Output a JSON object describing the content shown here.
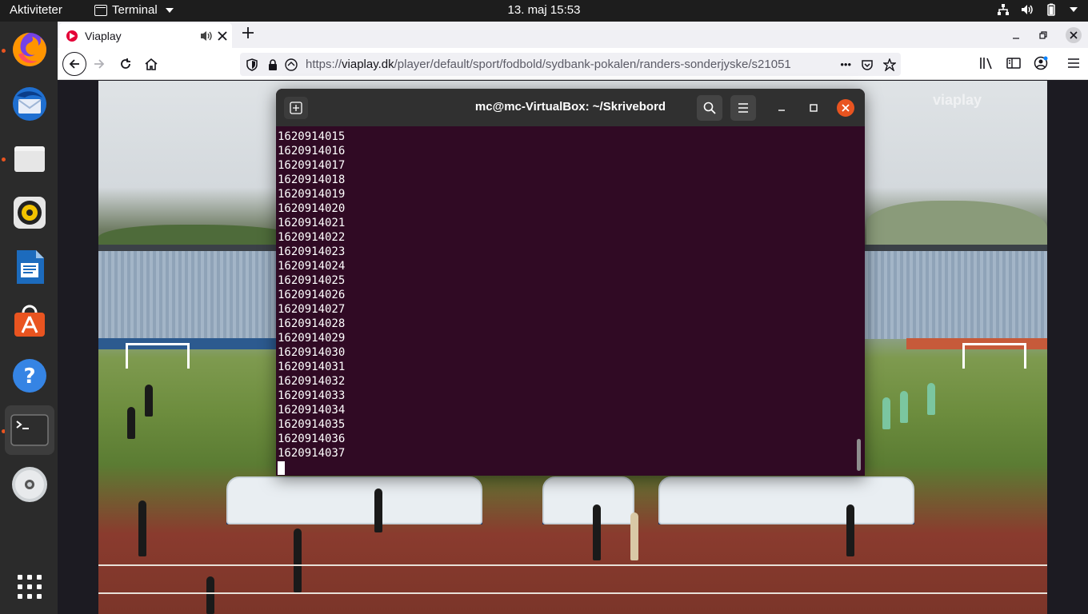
{
  "topbar": {
    "activities": "Aktiviteter",
    "app_name": "Terminal",
    "clock": "13. maj  15:53"
  },
  "dock": {
    "items": [
      {
        "name": "firefox",
        "running": true
      },
      {
        "name": "thunderbird",
        "running": false
      },
      {
        "name": "files",
        "running": true
      },
      {
        "name": "rhythmbox",
        "running": false
      },
      {
        "name": "libreoffice-writer",
        "running": false
      },
      {
        "name": "ubuntu-software",
        "running": false
      },
      {
        "name": "help",
        "running": false
      },
      {
        "name": "terminal",
        "running": true
      },
      {
        "name": "dvd",
        "running": false
      },
      {
        "name": "show-applications",
        "running": false
      }
    ]
  },
  "browser": {
    "tab_title": "Viaplay",
    "url_prefix": "https://",
    "url_host": "viaplay.dk",
    "url_path": "/player/default/sport/fodbold/sydbank-pokalen/randers-sonderjyske/s21051",
    "url_ellipsis": "•••"
  },
  "player": {
    "watermark": "viaplay"
  },
  "terminal": {
    "title": "mc@mc-VirtualBox: ~/Skrivebord",
    "lines": [
      "1620914015",
      "1620914016",
      "1620914017",
      "1620914018",
      "1620914019",
      "1620914020",
      "1620914021",
      "1620914022",
      "1620914023",
      "1620914024",
      "1620914025",
      "1620914026",
      "1620914027",
      "1620914028",
      "1620914029",
      "1620914030",
      "1620914031",
      "1620914032",
      "1620914033",
      "1620914034",
      "1620914035",
      "1620914036",
      "1620914037"
    ]
  },
  "colors": {
    "ubuntu_orange": "#e95420",
    "terminal_bg": "#300a24",
    "topbar_bg": "#1d1d1d",
    "dock_bg": "#2b2b2b"
  }
}
